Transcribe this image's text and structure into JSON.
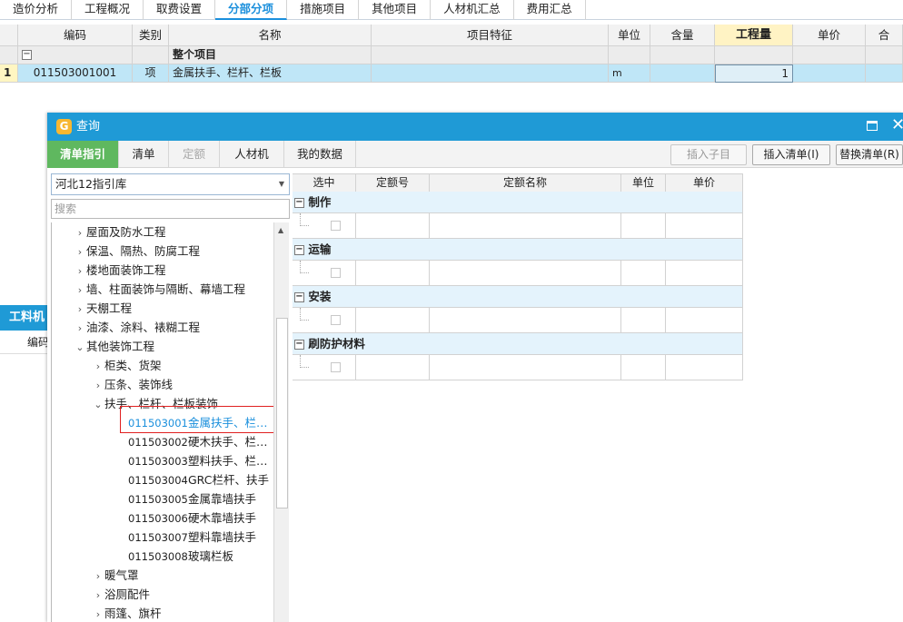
{
  "top_tabs": [
    {
      "label": "造价分析"
    },
    {
      "label": "工程概况"
    },
    {
      "label": "取费设置"
    },
    {
      "label": "分部分项",
      "active": true
    },
    {
      "label": "措施项目"
    },
    {
      "label": "其他项目"
    },
    {
      "label": "人材机汇总"
    },
    {
      "label": "费用汇总"
    }
  ],
  "grid": {
    "headers": [
      "编码",
      "类别",
      "名称",
      "项目特征",
      "单位",
      "含量",
      "工程量",
      "单价",
      "合"
    ],
    "section_row": {
      "name": "整个项目"
    },
    "rows": [
      {
        "num": "1",
        "code": "011503001001",
        "type": "项",
        "name": "金属扶手、栏杆、栏板",
        "feature": "",
        "unit": "m",
        "content": "",
        "qty": "1",
        "price": "",
        "total": ""
      }
    ]
  },
  "background_panel": {
    "tab_label": "工料机",
    "col_label": "编码"
  },
  "dialog": {
    "title": "查询",
    "tabs": [
      {
        "label": "清单指引",
        "active": true
      },
      {
        "label": "清单"
      },
      {
        "label": "定额",
        "disabled": true
      },
      {
        "label": "人材机"
      },
      {
        "label": "我的数据"
      }
    ],
    "buttons": [
      {
        "label": "插入子目",
        "disabled": true
      },
      {
        "label": "插入清单(I)"
      },
      {
        "label": "替换清单(R)"
      }
    ],
    "library_select": "河北12指引库",
    "search_placeholder": "搜索",
    "tree": [
      {
        "label": "屋面及防水工程",
        "level": 1,
        "expanded": false
      },
      {
        "label": "保温、隔热、防腐工程",
        "level": 1,
        "expanded": false
      },
      {
        "label": "楼地面装饰工程",
        "level": 1,
        "expanded": false
      },
      {
        "label": "墙、柱面装饰与隔断、幕墙工程",
        "level": 1,
        "expanded": false
      },
      {
        "label": "天棚工程",
        "level": 1,
        "expanded": false
      },
      {
        "label": "油漆、涂料、裱糊工程",
        "level": 1,
        "expanded": false
      },
      {
        "label": "其他装饰工程",
        "level": 1,
        "expanded": true
      },
      {
        "label": "柜类、货架",
        "level": 2,
        "expanded": false
      },
      {
        "label": "压条、装饰线",
        "level": 2,
        "expanded": false
      },
      {
        "label": "扶手、栏杆、栏板装饰",
        "level": 2,
        "expanded": true
      },
      {
        "code": "011503001",
        "label": "金属扶手、栏…",
        "level": 3,
        "selected": true
      },
      {
        "code": "011503002",
        "label": "硬木扶手、栏…",
        "level": 3
      },
      {
        "code": "011503003",
        "label": "塑料扶手、栏…",
        "level": 3
      },
      {
        "code": "011503004",
        "label": "GRC栏杆、扶手",
        "level": 3
      },
      {
        "code": "011503005",
        "label": "金属靠墙扶手",
        "level": 3
      },
      {
        "code": "011503006",
        "label": "硬木靠墙扶手",
        "level": 3
      },
      {
        "code": "011503007",
        "label": "塑料靠墙扶手",
        "level": 3
      },
      {
        "code": "011503008",
        "label": "玻璃栏板",
        "level": 3
      },
      {
        "label": "暖气罩",
        "level": 2,
        "expanded": false
      },
      {
        "label": "浴厕配件",
        "level": 2,
        "expanded": false
      },
      {
        "label": "雨篷、旗杆",
        "level": 2,
        "expanded": false
      }
    ],
    "right_table": {
      "headers": [
        "选中",
        "定额号",
        "定额名称",
        "单位",
        "单价"
      ],
      "groups": [
        {
          "name": "制作"
        },
        {
          "name": "运输"
        },
        {
          "name": "安装"
        },
        {
          "name": "刷防护材料"
        }
      ]
    }
  },
  "colors": {
    "accent_blue": "#1f9ad6",
    "active_tab_green": "#5fb85f",
    "selected_row": "#bfe6f7",
    "highlight_box": "#e02020"
  }
}
